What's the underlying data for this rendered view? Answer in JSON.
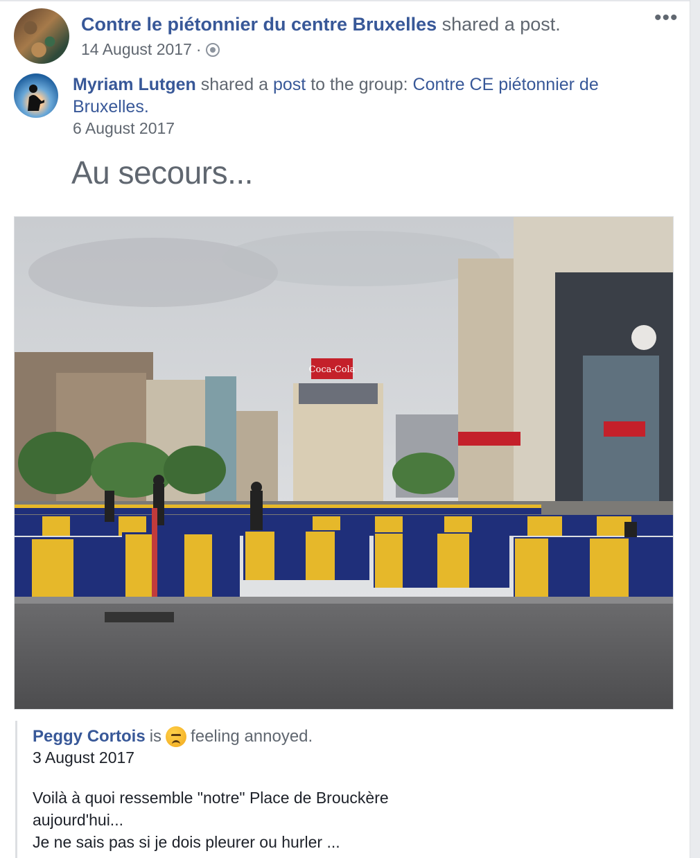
{
  "post": {
    "page_name": "Contre le piétonnier du centre Bruxelles",
    "action_text": "shared a post.",
    "date": "14 August 2017",
    "date_separator": "·",
    "privacy_icon": "globe-icon",
    "more_icon": "•••"
  },
  "shared": {
    "user_name": "Myriam Lutgen",
    "text_1": " shared a ",
    "post_link": "post",
    "text_2": " to the group: ",
    "group_name": "Contre CE piétonnier de Bruxelles",
    "text_3": ".",
    "date": "6 August 2017",
    "message": "Au secours..."
  },
  "photo": {
    "sign_text": "Coca-Cola"
  },
  "quote": {
    "author": "Peggy Cortois",
    "is_text": "is",
    "emoji": "annoyed-face",
    "feeling_text": "feeling annoyed.",
    "date": "3 August 2017",
    "lines": [
      "Voilà à quoi ressemble \"notre\" Place de Brouckère",
      "aujourd'hui...",
      "Je ne sais pas si je dois pleurer ou hurler ..."
    ]
  },
  "colors": {
    "link": "#385898",
    "muted": "#606770",
    "barrier_blue": "#1f2f7a",
    "barrier_yellow": "#e6b82a"
  }
}
